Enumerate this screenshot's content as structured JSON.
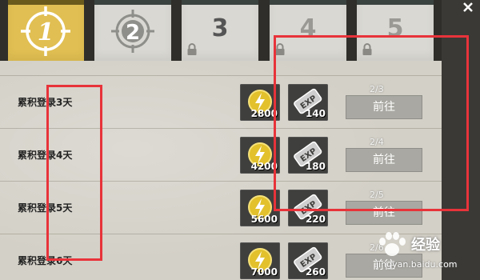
{
  "tabs": [
    {
      "label": "1",
      "state": "active"
    },
    {
      "label": "2",
      "state": "unlocked"
    },
    {
      "label": "3",
      "state": "locked"
    },
    {
      "label": "4",
      "state": "locked"
    },
    {
      "label": "5",
      "state": "locked"
    }
  ],
  "rows": [
    {
      "label": "累积登录3天",
      "coins": "2800",
      "exp": "140",
      "progress": "2/3",
      "button": "前往"
    },
    {
      "label": "累积登录4天",
      "coins": "4200",
      "exp": "180",
      "progress": "2/4",
      "button": "前往"
    },
    {
      "label": "累积登录5天",
      "coins": "5600",
      "exp": "220",
      "progress": "2/5",
      "button": "前往"
    },
    {
      "label": "累积登录6天",
      "coins": "7000",
      "exp": "260",
      "progress": "2/6",
      "button": "前往"
    }
  ],
  "watermark": {
    "brand": "经验",
    "url": "jingyan.baidu.com"
  },
  "colors": {
    "active_tab": "#e1bf52",
    "tab": "#d9d8d2",
    "highlight": "#e8333a"
  },
  "icons": [
    "crosshair-icon",
    "lock-icon",
    "coin-icon",
    "exp-card-icon",
    "close-icon"
  ]
}
